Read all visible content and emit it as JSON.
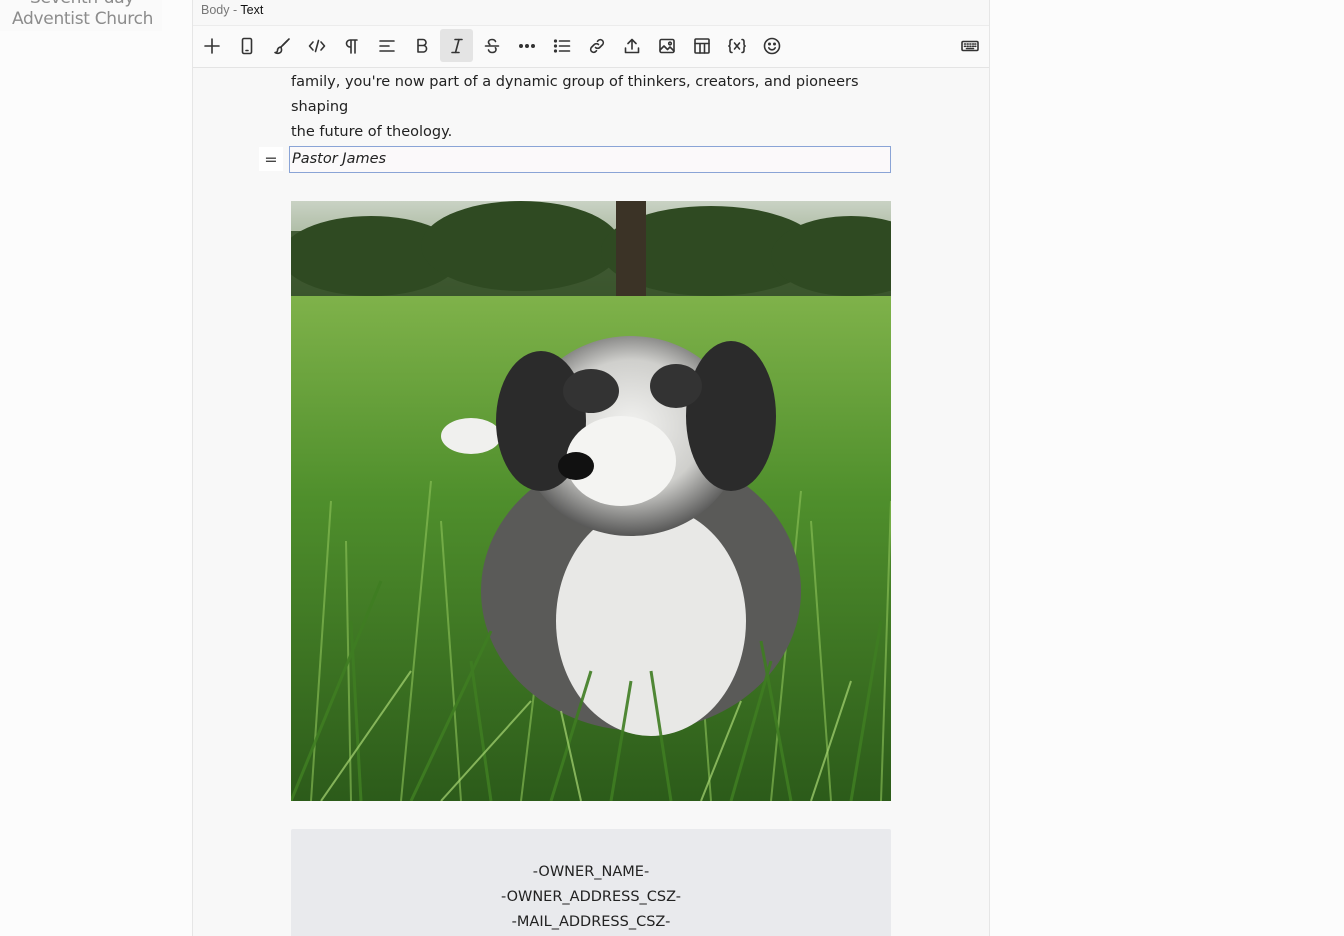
{
  "logo": {
    "line1": "Seventh-day",
    "line2": "Adventist Church"
  },
  "breadcrumb": {
    "parent": "Body",
    "separator": "-",
    "current": "Text"
  },
  "toolbar": {
    "buttons": [
      {
        "name": "add-block-button",
        "icon": "plus-icon"
      },
      {
        "name": "mobile-preview-button",
        "icon": "mobile-icon"
      },
      {
        "name": "style-brush-button",
        "icon": "brush-icon"
      },
      {
        "name": "code-button",
        "icon": "code-icon"
      },
      {
        "name": "paragraph-button",
        "icon": "pilcrow-icon"
      },
      {
        "name": "align-button",
        "icon": "align-left-icon"
      },
      {
        "name": "bold-button",
        "icon": "bold-icon",
        "glyph": "B"
      },
      {
        "name": "italic-button",
        "icon": "italic-icon",
        "glyph": "I",
        "active": true
      },
      {
        "name": "strikethrough-button",
        "icon": "strikethrough-icon",
        "glyph": "S"
      },
      {
        "name": "more-button",
        "icon": "ellipsis-icon"
      },
      {
        "name": "list-button",
        "icon": "list-icon"
      },
      {
        "name": "link-button",
        "icon": "link-icon"
      },
      {
        "name": "upload-button",
        "icon": "upload-icon"
      },
      {
        "name": "image-button",
        "icon": "image-icon"
      },
      {
        "name": "table-button",
        "icon": "table-icon"
      },
      {
        "name": "variable-button",
        "icon": "variable-icon",
        "glyph": "{x}"
      },
      {
        "name": "emoji-button",
        "icon": "emoji-icon"
      },
      {
        "name": "keyboard-button",
        "icon": "keyboard-icon"
      }
    ]
  },
  "content": {
    "paragraph_line1": "family, you're now part of a dynamic group of thinkers, creators, and pioneers shaping",
    "paragraph_line2": "the future of theology.",
    "signature": "Pastor James",
    "drag_handle": "=",
    "address": {
      "line1": "-OWNER_NAME-",
      "line2": "-OWNER_ADDRESS_CSZ-",
      "line3": "-MAIL_ADDRESS_CSZ-"
    }
  },
  "colors": {
    "selection_border": "#8aa4d6",
    "address_bg": "#e9eaed",
    "active_tool_bg": "#e4e4e4"
  }
}
